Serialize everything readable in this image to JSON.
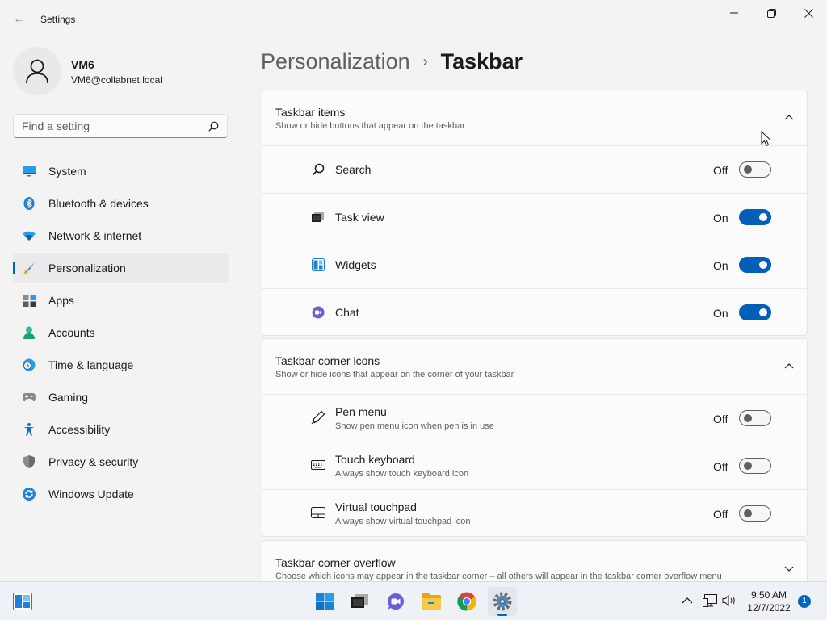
{
  "window": {
    "title": "Settings",
    "back_glyph": "←"
  },
  "profile": {
    "name": "VM6",
    "email": "VM6@collabnet.local"
  },
  "search": {
    "placeholder": "Find a setting",
    "value": ""
  },
  "nav": {
    "items": [
      {
        "label": "System",
        "icon": "system-icon"
      },
      {
        "label": "Bluetooth & devices",
        "icon": "bluetooth-icon"
      },
      {
        "label": "Network & internet",
        "icon": "wifi-icon"
      },
      {
        "label": "Personalization",
        "icon": "brush-icon",
        "selected": true
      },
      {
        "label": "Apps",
        "icon": "apps-icon"
      },
      {
        "label": "Accounts",
        "icon": "person-icon"
      },
      {
        "label": "Time & language",
        "icon": "clock-globe-icon"
      },
      {
        "label": "Gaming",
        "icon": "gamepad-icon"
      },
      {
        "label": "Accessibility",
        "icon": "accessibility-icon"
      },
      {
        "label": "Privacy & security",
        "icon": "shield-icon"
      },
      {
        "label": "Windows Update",
        "icon": "update-icon"
      }
    ]
  },
  "breadcrumb": {
    "parent": "Personalization",
    "separator": "›",
    "current": "Taskbar"
  },
  "sections": {
    "taskbar_items": {
      "title": "Taskbar items",
      "subtitle": "Show or hide buttons that appear on the taskbar",
      "expanded": true,
      "rows": [
        {
          "label": "Search",
          "state": "Off",
          "on": false,
          "icon": "search-icon"
        },
        {
          "label": "Task view",
          "state": "On",
          "on": true,
          "icon": "task-view-icon"
        },
        {
          "label": "Widgets",
          "state": "On",
          "on": true,
          "icon": "widgets-icon"
        },
        {
          "label": "Chat",
          "state": "On",
          "on": true,
          "icon": "chat-icon"
        }
      ]
    },
    "corner_icons": {
      "title": "Taskbar corner icons",
      "subtitle": "Show or hide icons that appear on the corner of your taskbar",
      "expanded": true,
      "rows": [
        {
          "label": "Pen menu",
          "sub": "Show pen menu icon when pen is in use",
          "state": "Off",
          "on": false,
          "icon": "pen-icon"
        },
        {
          "label": "Touch keyboard",
          "sub": "Always show touch keyboard icon",
          "state": "Off",
          "on": false,
          "icon": "keyboard-icon"
        },
        {
          "label": "Virtual touchpad",
          "sub": "Always show virtual touchpad icon",
          "state": "Off",
          "on": false,
          "icon": "touchpad-icon"
        }
      ]
    },
    "corner_overflow": {
      "title": "Taskbar corner overflow",
      "subtitle": "Choose which icons may appear in the taskbar corner – all others will appear in the taskbar corner overflow menu",
      "expanded": false
    }
  },
  "taskbar": {
    "apps": [
      "widgets-icon",
      "start-icon",
      "task-view-icon",
      "chat-icon",
      "file-explorer-icon",
      "chrome-icon",
      "settings-icon"
    ],
    "active_app": "settings-icon",
    "time": "9:50 AM",
    "date": "12/7/2022",
    "notification_count": "1"
  },
  "colors": {
    "accent": "#0067c0",
    "toggle_on": "#005fb8",
    "background": "#f3f3f3",
    "card": "#fbfbfb"
  }
}
